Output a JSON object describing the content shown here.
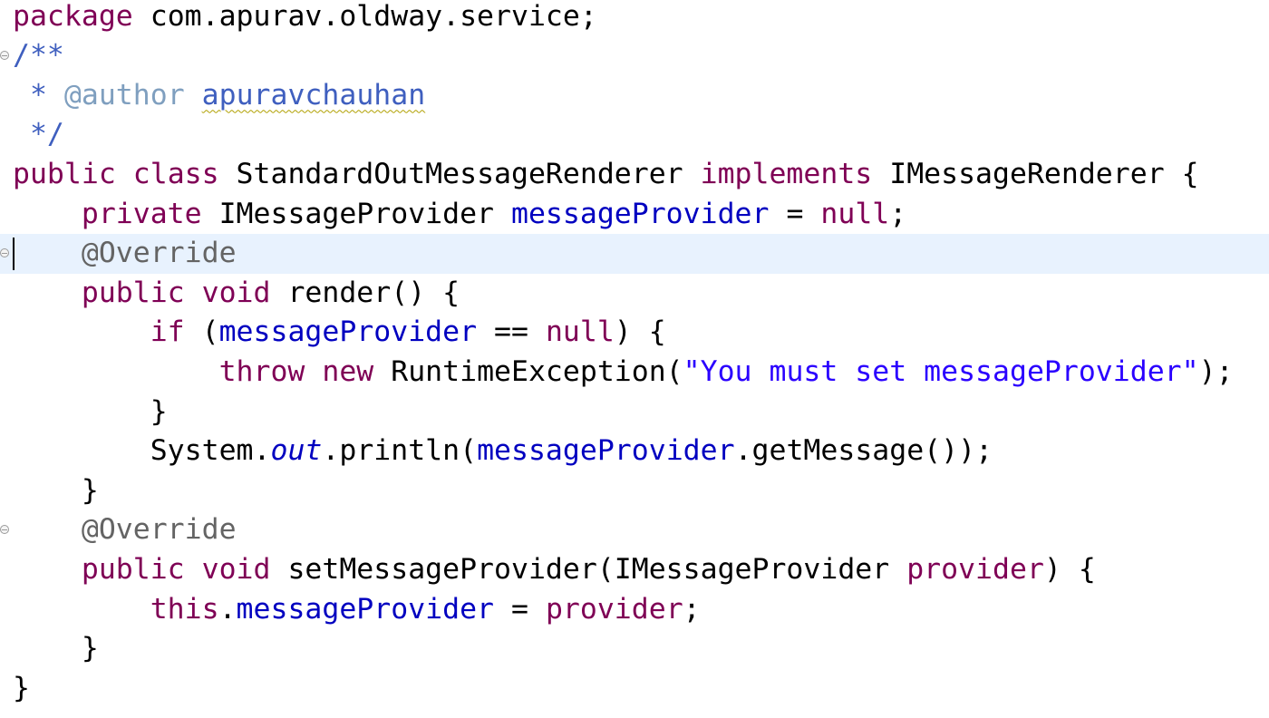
{
  "editor": {
    "current_line": 7,
    "colors": {
      "keyword": "#7f0055",
      "javadoc": "#3f5fbf",
      "javadoc_tag": "#7f9fbf",
      "field": "#0000c0",
      "string": "#2a00ff",
      "annotation": "#646464",
      "current_line_highlight": "#e8f2fe"
    },
    "fold_markers": [
      "collapse-icon",
      "collapse-icon",
      "collapse-icon"
    ],
    "lines": [
      {
        "t": [
          [
            "kw",
            "package"
          ],
          [
            "p",
            " com.apurav.oldway.service;"
          ]
        ]
      },
      {
        "t": [
          [
            "jd",
            "/**"
          ]
        ]
      },
      {
        "t": [
          [
            "jd",
            " * "
          ],
          [
            "jdtag",
            "@author"
          ],
          [
            "jd",
            " "
          ],
          [
            "jd spell",
            "apuravchauhan"
          ]
        ]
      },
      {
        "t": [
          [
            "jd",
            " */"
          ]
        ]
      },
      {
        "t": [
          [
            "kw",
            "public"
          ],
          [
            "p",
            " "
          ],
          [
            "kw",
            "class"
          ],
          [
            "p",
            " StandardOutMessageRenderer "
          ],
          [
            "kw",
            "implements"
          ],
          [
            "p",
            " IMessageRenderer {"
          ]
        ]
      },
      {
        "t": [
          [
            "p",
            "    "
          ],
          [
            "kw",
            "private"
          ],
          [
            "p",
            " IMessageProvider "
          ],
          [
            "fld",
            "messageProvider"
          ],
          [
            "p",
            " = "
          ],
          [
            "kw",
            "null"
          ],
          [
            "p",
            ";"
          ]
        ]
      },
      {
        "t": [
          [
            "p",
            "    "
          ],
          [
            "ann",
            "@Override"
          ]
        ]
      },
      {
        "t": [
          [
            "p",
            "    "
          ],
          [
            "kw",
            "public"
          ],
          [
            "p",
            " "
          ],
          [
            "kw",
            "void"
          ],
          [
            "p",
            " render() {"
          ]
        ]
      },
      {
        "t": [
          [
            "p",
            "        "
          ],
          [
            "kw",
            "if"
          ],
          [
            "p",
            " ("
          ],
          [
            "fld",
            "messageProvider"
          ],
          [
            "p",
            " == "
          ],
          [
            "kw",
            "null"
          ],
          [
            "p",
            ") {"
          ]
        ]
      },
      {
        "t": [
          [
            "p",
            "            "
          ],
          [
            "kw",
            "throw"
          ],
          [
            "p",
            " "
          ],
          [
            "kw",
            "new"
          ],
          [
            "p",
            " RuntimeException("
          ],
          [
            "str",
            "\"You must set messageProvider\""
          ],
          [
            "p",
            ");"
          ]
        ]
      },
      {
        "t": [
          [
            "p",
            "        }"
          ]
        ]
      },
      {
        "t": [
          [
            "p",
            "        System."
          ],
          [
            "sfld",
            "out"
          ],
          [
            "p",
            ".println("
          ],
          [
            "fld",
            "messageProvider"
          ],
          [
            "p",
            ".getMessage());"
          ]
        ]
      },
      {
        "t": [
          [
            "p",
            "    }"
          ]
        ]
      },
      {
        "t": [
          [
            "p",
            "    "
          ],
          [
            "ann",
            "@Override"
          ]
        ]
      },
      {
        "t": [
          [
            "p",
            "    "
          ],
          [
            "kw",
            "public"
          ],
          [
            "p",
            " "
          ],
          [
            "kw",
            "void"
          ],
          [
            "p",
            " setMessageProvider(IMessageProvider "
          ],
          [
            "kw",
            "provider"
          ],
          [
            "p",
            ") {"
          ]
        ]
      },
      {
        "t": [
          [
            "p",
            "        "
          ],
          [
            "kw",
            "this"
          ],
          [
            "p",
            "."
          ],
          [
            "fld",
            "messageProvider"
          ],
          [
            "p",
            " = "
          ],
          [
            "kw",
            "provider"
          ],
          [
            "p",
            ";"
          ]
        ]
      },
      {
        "t": [
          [
            "p",
            "    }"
          ]
        ]
      },
      {
        "t": [
          [
            "p",
            "}"
          ]
        ]
      }
    ]
  }
}
